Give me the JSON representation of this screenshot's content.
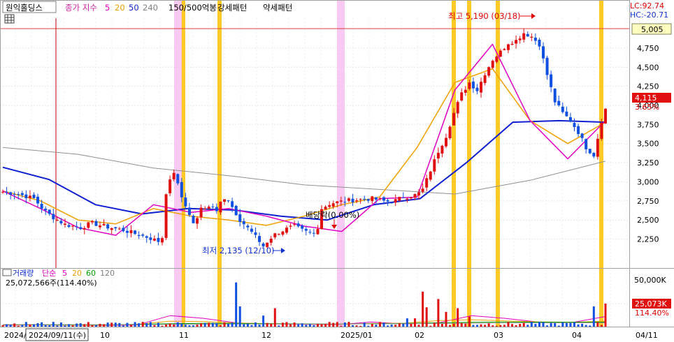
{
  "header": {
    "stock_name": "원익홀딩스",
    "ma_label": "종가 지수",
    "ma_periods": [
      "5",
      "20",
      "50",
      "240"
    ],
    "ma_colors": [
      "#e000c0",
      "#f0a000",
      "#1020d0",
      "#909090"
    ],
    "pattern_label": "150/500억봉",
    "strong_label": "강세패턴",
    "weak_label": "약세패턴",
    "lc": "LC:92.74",
    "hc": "HC:-20.71"
  },
  "price_axis": {
    "ticks": [
      "4,750",
      "4,500",
      "4,250",
      "4,000",
      "3,750",
      "3,500",
      "3,250",
      "3,000",
      "2,750",
      "2,500",
      "2,250"
    ],
    "reference_label": "5,005",
    "current_label": "4,115",
    "change_label": "3.65%"
  },
  "annotations": {
    "high": "최고 5,190 (03/18)",
    "low": "최저 2,135 (12/10)",
    "dividend": "배당락(0.00%)"
  },
  "volume_header": {
    "label": "거래량",
    "ma_label": "단순",
    "ma_periods": [
      "5",
      "20",
      "60",
      "120"
    ],
    "ma_colors": [
      "#e000c0",
      "#f0a000",
      "#00a000",
      "#909090"
    ],
    "value": "25,072,566주(114.40%)"
  },
  "volume_axis": {
    "tick": "50,000K",
    "current_label": "25,073K",
    "percent_label": "114.40%"
  },
  "date_axis": {
    "year_label": "2024/",
    "selected_date": "2024/09/11(수)",
    "ticks": [
      "10",
      "11",
      "12",
      "2025/01",
      "02",
      "03",
      "04",
      "04/11"
    ]
  },
  "chart_data": {
    "type": "candlestick",
    "title": "원익홀딩스",
    "y_axis_range": [
      2100,
      5005
    ],
    "high": {
      "value": 5190,
      "date": "03/18"
    },
    "low": {
      "value": 2135,
      "date": "12/10"
    },
    "reference_price": 5005,
    "last_price": 4115,
    "last_change_percent": 3.65,
    "last_volume": 25072566,
    "last_volume_percent": 114.4,
    "ma_anchor_values": {
      "ma5": [
        2880,
        2650,
        2400,
        2300,
        2700,
        2600,
        2650,
        2550,
        2420,
        2350,
        2780,
        2800,
        4200,
        4800,
        3800,
        3300,
        3800
      ],
      "ma20": [
        2880,
        2750,
        2500,
        2450,
        2650,
        2550,
        2500,
        2430,
        2550,
        2700,
        2800,
        3450,
        4300,
        4480,
        3800,
        3500,
        3780
      ],
      "ma50": [
        3190,
        3030,
        2700,
        2580,
        2650,
        2630,
        2550,
        2500,
        2700,
        2780,
        3250,
        3780,
        3800,
        3780
      ],
      "ma240": [
        3450,
        3360,
        3180,
        3080,
        2960,
        2900,
        2840,
        3020,
        3270
      ]
    },
    "strong_signal_days": [
      "11/01",
      "11/14",
      "02/13",
      "02/24",
      "03/04",
      "04/04"
    ],
    "weak_signal_days": [
      "10/31",
      "12/26"
    ]
  }
}
